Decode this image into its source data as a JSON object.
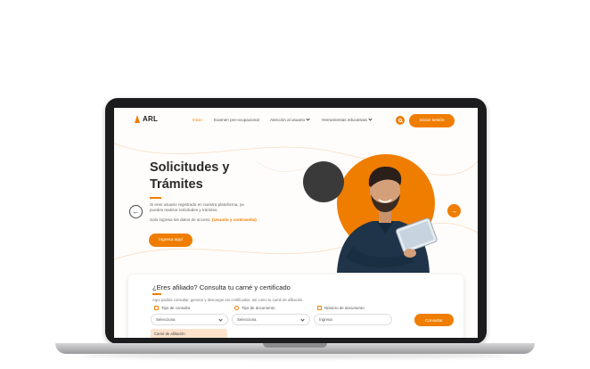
{
  "brand": {
    "logo_text": "ARL",
    "accent": "#ef7d00"
  },
  "nav": {
    "items": [
      {
        "label": "Inicio",
        "active": true
      },
      {
        "label": "Examen pre-ocupacional",
        "active": false
      },
      {
        "label": "Atención al usuario",
        "active": false,
        "dropdown": true
      },
      {
        "label": "Herramientas educativas",
        "active": false,
        "dropdown": true
      }
    ],
    "search_icon": "search-icon",
    "login_label": "Iniciar sesión"
  },
  "hero": {
    "title": "Solicitudes y Trámites",
    "description": "Si eres usuario registrado en nuestra plataforma, ya puedes realizar solicitudes y trámites.",
    "note_prefix": "Solo ingresa los datos de acceso.",
    "note_highlight": "(Usuario y contraseña)",
    "cta_label": "Ingresa aquí",
    "prev_icon": "arrow-left-icon",
    "next_icon": "arrow-right-icon"
  },
  "form": {
    "title": "¿Eres afiliado? Consulta tu carné y certificado",
    "description": "Aquí podrás consultar, generar y descargar tus certificados, así como tu carné de afiliación.",
    "fields": [
      {
        "label": "Tipo de consulta",
        "value": "Selecciona",
        "icon": "refresh-icon"
      },
      {
        "label": "Tipo de documento",
        "value": "Selecciona",
        "icon": "user-icon"
      },
      {
        "label": "Número de documento",
        "placeholder": "Ingresa",
        "icon": "id-card-icon"
      }
    ],
    "submit_label": "Consultar",
    "dropdown_option": "Carné de afiliación"
  }
}
